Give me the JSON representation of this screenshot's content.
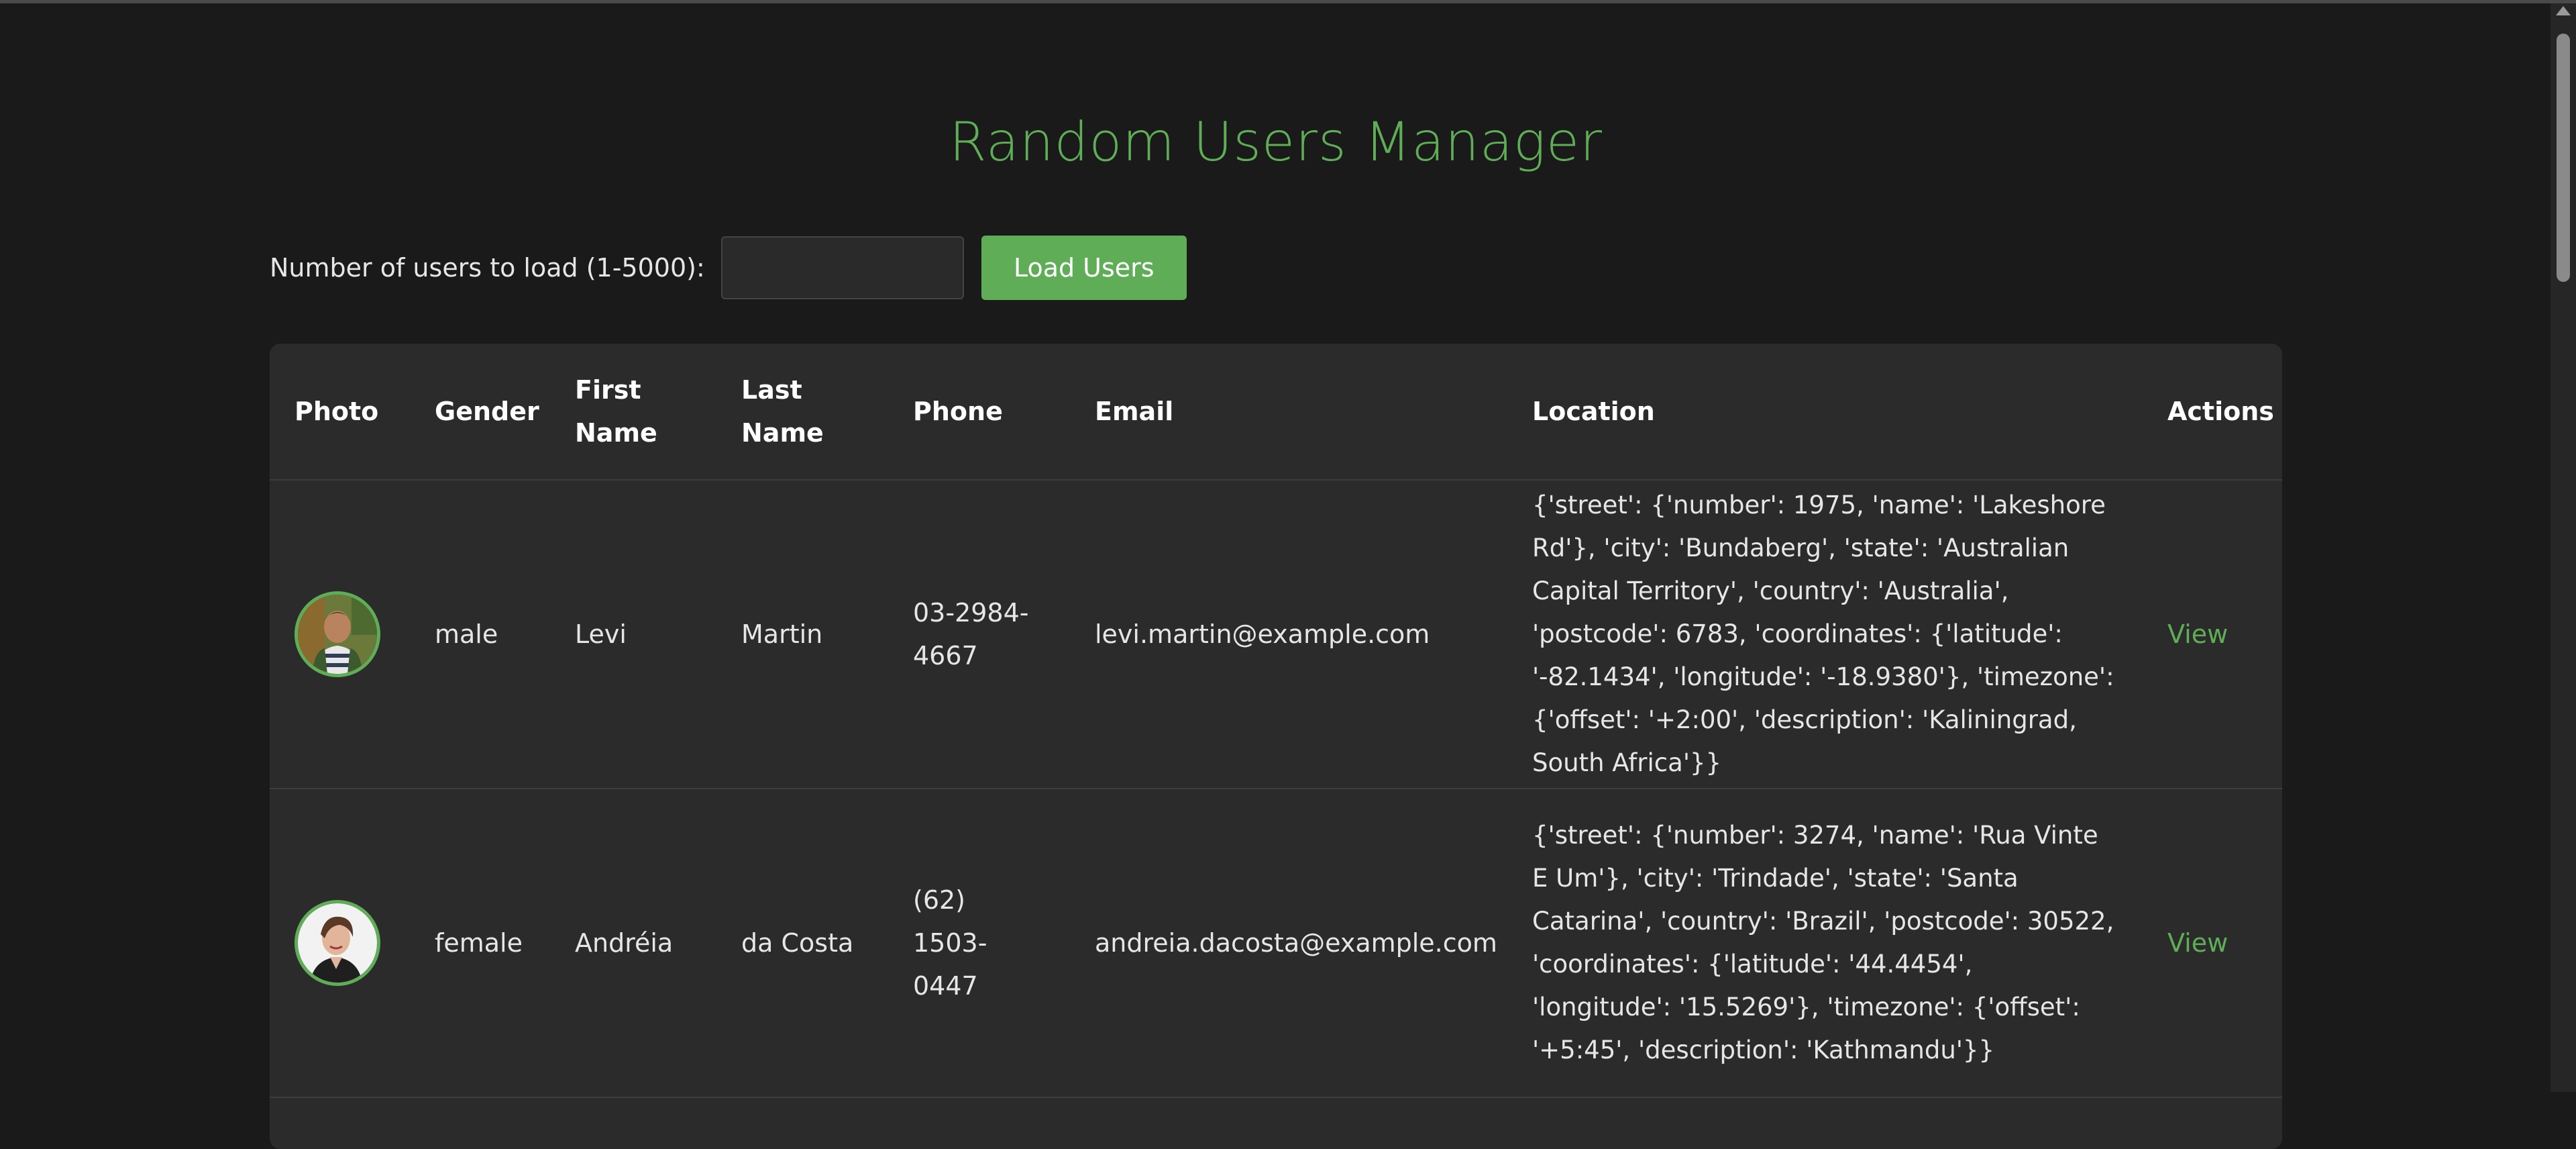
{
  "page": {
    "title": "Random Users Manager"
  },
  "controls": {
    "label": "Number of users to load (1-5000):",
    "input_value": "",
    "input_placeholder": "",
    "load_button": "Load Users"
  },
  "table": {
    "headers": {
      "photo": "Photo",
      "gender": "Gender",
      "first_name": "First Name",
      "last_name": "Last Name",
      "phone": "Phone",
      "email": "Email",
      "location": "Location",
      "actions": "Actions"
    },
    "rows": [
      {
        "gender": "male",
        "first_name": "Levi",
        "last_name": "Martin",
        "phone": "03-2984-4667",
        "email": "levi.martin@example.com",
        "location": "{'street': {'number': 1975, 'name': 'Lakeshore Rd'}, 'city': 'Bundaberg', 'state': 'Australian Capital Territory', 'country': 'Australia', 'postcode': 6783, 'coordinates': {'latitude': '-82.1434', 'longitude': '-18.9380'}, 'timezone': {'offset': '+2:00', 'description': 'Kaliningrad, South Africa'}}",
        "action": "View"
      },
      {
        "gender": "female",
        "first_name": "Andréia",
        "last_name": "da Costa",
        "phone": "(62) 1503-0447",
        "email": "andreia.dacosta@example.com",
        "location": "{'street': {'number': 3274, 'name': 'Rua Vinte E Um'}, 'city': 'Trindade', 'state': 'Santa Catarina', 'country': 'Brazil', 'postcode': 30522, 'coordinates': {'latitude': '44.4454', 'longitude': '15.5269'}, 'timezone': {'offset': '+5:45', 'description': 'Kathmandu'}}",
        "action": "View"
      }
    ]
  },
  "colors": {
    "background": "#1a1a1a",
    "accent": "#5fae57",
    "card": "#2b2b2b"
  }
}
